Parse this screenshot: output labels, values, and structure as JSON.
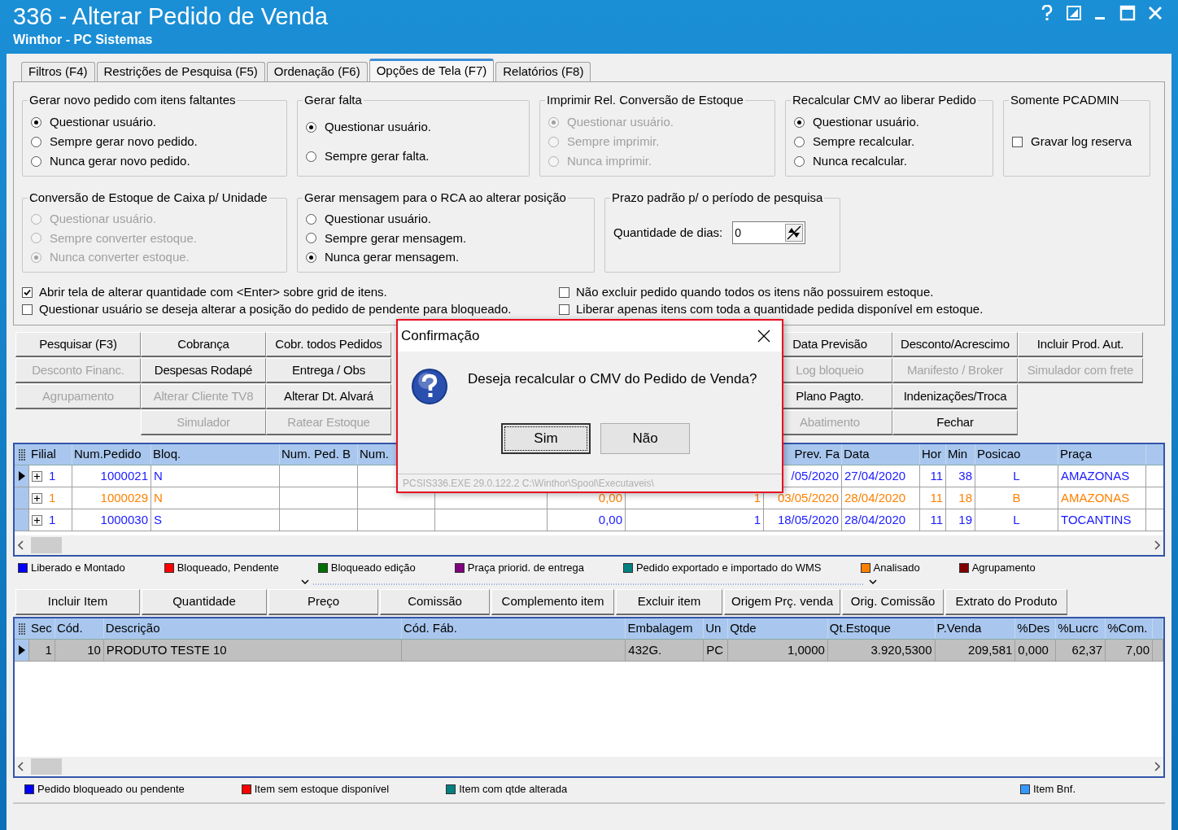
{
  "window": {
    "title": "336 - Alterar Pedido de Venda",
    "subtitle": "Winthor - PC Sistemas"
  },
  "tabs": [
    {
      "label": "Filtros (F4)",
      "selected": false
    },
    {
      "label": "Restrições de Pesquisa (F5)",
      "selected": false
    },
    {
      "label": "Ordenação (F6)",
      "selected": false
    },
    {
      "label": "Opções de Tela (F7)",
      "selected": true
    },
    {
      "label": "Relatórios (F8)",
      "selected": false
    }
  ],
  "option_rows": [
    {
      "groups": [
        {
          "title": "Gerar novo pedido com itens faltantes",
          "kind": "radio",
          "disabled": false,
          "options": [
            {
              "label": "Questionar usuário.",
              "selected": true
            },
            {
              "label": "Sempre gerar novo pedido.",
              "selected": false
            },
            {
              "label": "Nunca gerar novo pedido.",
              "selected": false
            }
          ]
        },
        {
          "title": "Gerar falta",
          "kind": "radio",
          "disabled": false,
          "options": [
            {
              "label": "Questionar usuário.",
              "selected": true
            },
            {
              "label": "Sempre gerar falta.",
              "selected": false
            }
          ]
        },
        {
          "title": "Imprimir Rel. Conversão de Estoque",
          "kind": "radio",
          "disabled": true,
          "options": [
            {
              "label": "Questionar usuário.",
              "selected": true
            },
            {
              "label": "Sempre imprimir.",
              "selected": false
            },
            {
              "label": "Nunca imprimir.",
              "selected": false
            }
          ]
        },
        {
          "title": "Recalcular CMV ao liberar Pedido",
          "kind": "radio",
          "disabled": false,
          "options": [
            {
              "label": "Questionar usuário.",
              "selected": true
            },
            {
              "label": "Sempre recalcular.",
              "selected": false
            },
            {
              "label": "Nunca recalcular.",
              "selected": false
            }
          ]
        },
        {
          "title": "Somente PCADMIN",
          "kind": "checkbox",
          "disabled": false,
          "options": [
            {
              "label": "Gravar log reserva",
              "checked": false
            }
          ]
        }
      ]
    },
    {
      "groups": [
        {
          "title": "Conversão de Estoque de Caixa p/ Unidade",
          "kind": "radio",
          "disabled": true,
          "options": [
            {
              "label": "Questionar usuário.",
              "selected": false
            },
            {
              "label": "Sempre converter estoque.",
              "selected": false
            },
            {
              "label": "Nunca converter estoque.",
              "selected": true
            }
          ]
        },
        {
          "title": "Gerar mensagem para o RCA ao alterar posição",
          "kind": "radio",
          "disabled": false,
          "options": [
            {
              "label": "Questionar usuário.",
              "selected": false
            },
            {
              "label": "Sempre gerar mensagem.",
              "selected": false
            },
            {
              "label": "Nunca gerar mensagem.",
              "selected": true
            }
          ]
        },
        {
          "title": "Prazo padrão p/ o período de pesquisa",
          "kind": "number",
          "label": "Quantidade de dias:",
          "value": "0"
        }
      ]
    }
  ],
  "flags_left": [
    {
      "label": "Abrir tela de alterar quantidade com <Enter> sobre grid de itens.",
      "checked": true
    },
    {
      "label": "Questionar usuário se deseja alterar a posição do pedido de pendente para bloqueado.",
      "checked": false
    }
  ],
  "flags_right": [
    {
      "label": "Não excluir pedido quando todos os itens não possuirem estoque.",
      "checked": false
    },
    {
      "label": "Liberar apenas itens com toda a quantidade pedida disponível em estoque.",
      "checked": false
    }
  ],
  "left_button_columns": [
    [
      {
        "label": "Pesquisar (F3)",
        "disabled": false
      },
      {
        "label": "Desconto Financ.",
        "disabled": true
      },
      {
        "label": "Agrupamento",
        "disabled": true
      }
    ],
    [
      {
        "label": "Cobrança",
        "disabled": false
      },
      {
        "label": "Despesas Rodapé",
        "disabled": false
      },
      {
        "label": "Alterar Cliente TV8",
        "disabled": true
      },
      {
        "label": "Simulador",
        "disabled": true
      }
    ],
    [
      {
        "label": "Cobr. todos Pedidos",
        "disabled": false
      },
      {
        "label": "Entrega / Obs",
        "disabled": false
      },
      {
        "label": "Alterar Dt. Alvará",
        "disabled": false
      },
      {
        "label": "Ratear Estoque",
        "disabled": true
      }
    ]
  ],
  "right_button_columns": [
    [
      {
        "label": "Data Previsão",
        "disabled": false
      },
      {
        "label": "Log bloqueio",
        "disabled": true
      },
      {
        "label": "Plano Pagto.",
        "disabled": false
      },
      {
        "label": "Abatimento",
        "disabled": true
      }
    ],
    [
      {
        "label": "Desconto/Acrescimo",
        "disabled": false
      },
      {
        "label": "Manifesto / Broker",
        "disabled": true
      },
      {
        "label": "Indenizações/Troca",
        "disabled": false
      },
      {
        "label": "Fechar",
        "disabled": false
      }
    ],
    [
      {
        "label": "Incluir Prod. Aut.",
        "disabled": false
      },
      {
        "label": "Simulador com frete",
        "disabled": true
      }
    ]
  ],
  "orders_grid": {
    "columns": {
      "filial": "Filial",
      "num_pedido": "Num.Pedido",
      "bloq": "Bloq.",
      "num_ped_b": "Num. Ped. B",
      "num": "Num.",
      "prev_fa": "Prev. Fa",
      "data": "Data",
      "hor": "Hor",
      "min": "Min",
      "posicao": "Posicao",
      "praca": "Praça"
    },
    "rows": [
      {
        "current": true,
        "color": "#1a1aff",
        "cells": {
          "filial": "1",
          "num_pedido": "1000021",
          "bloq": "N",
          "prev_fa": "/05/2020",
          "data": "27/04/2020",
          "hor": "11",
          "min": "38",
          "posicao": "L",
          "praca": "AMAZONAS"
        }
      },
      {
        "current": false,
        "color": "#ff8000",
        "cells": {
          "filial": "1",
          "num_pedido": "1000029",
          "bloq": "N",
          "column_7": "0,00",
          "column_8": "1",
          "prev_fa": "03/05/2020",
          "data": "28/04/2020",
          "hor": "11",
          "min": "18",
          "posicao": "B",
          "praca": "AMAZONAS"
        }
      },
      {
        "current": false,
        "color": "#1a1aff",
        "cells": {
          "filial": "1",
          "num_pedido": "1000030",
          "bloq": "S",
          "column_7": "0,00",
          "column_8": "1",
          "prev_fa": "18/05/2020",
          "data": "28/04/2020",
          "hor": "11",
          "min": "19",
          "posicao": "L",
          "praca": "TOCANTINS"
        }
      }
    ]
  },
  "orders_legend": [
    {
      "label": "Liberado e Montado",
      "color": "#0000ff"
    },
    {
      "label": "Bloqueado, Pendente",
      "color": "#ff0000"
    },
    {
      "label": "Bloqueado edição",
      "color": "#007000"
    },
    {
      "label": "Praça priorid. de entrega",
      "color": "#800080"
    },
    {
      "label": "Pedido exportado e importado do WMS",
      "color": "#008080"
    },
    {
      "label": "Analisado",
      "color": "#ff8000"
    },
    {
      "label": "Agrupamento",
      "color": "#800000"
    }
  ],
  "item_buttons": [
    "Incluir Item",
    "Quantidade",
    "Preço",
    "Comissão",
    "Complemento item",
    "Excluir item",
    "Origem Prç. venda",
    "Orig. Comissão",
    "Extrato do Produto"
  ],
  "items_grid": {
    "columns": {
      "seq": "Sec",
      "cod": "Cód.",
      "descricao": "Descrição",
      "cod_fab": "Cód. Fáb.",
      "embalagem": "Embalagem",
      "un": "Un",
      "qtde": "Qtde",
      "qt_estoque": "Qt.Estoque",
      "p_venda": "P.Venda",
      "pct_des": "%Des",
      "pct_lucro": "%Lucrc",
      "pct_com": "%Com."
    },
    "rows": [
      {
        "current": true,
        "cells": {
          "seq": "1",
          "cod": "10",
          "descricao": "PRODUTO TESTE 10",
          "embalagem": "432G.",
          "un": "PC",
          "qtde": "1,0000",
          "qt_estoque": "3.920,5300",
          "p_venda": "209,581",
          "pct_des": "0,000",
          "pct_lucro": "62,37",
          "pct_com": "7,00"
        }
      }
    ]
  },
  "items_legend": [
    {
      "label": "Pedido bloqueado ou pendente",
      "color": "#0000ff"
    },
    {
      "label": "Item sem estoque disponível",
      "color": "#ff0000"
    },
    {
      "label": "Item com qtde alterada",
      "color": "#008080"
    },
    {
      "label": "Item Bnf.",
      "color": "#3399ff"
    }
  ],
  "dialog": {
    "title": "Confirmação",
    "message": "Deseja recalcular o CMV do Pedido de Venda?",
    "buttons": [
      {
        "label": "Sim",
        "focused": true
      },
      {
        "label": "Não",
        "focused": false
      }
    ],
    "status": "PCSIS336.EXE 29.0.122.2 C:\\Winthor\\Spool\\Executaveis\\"
  }
}
